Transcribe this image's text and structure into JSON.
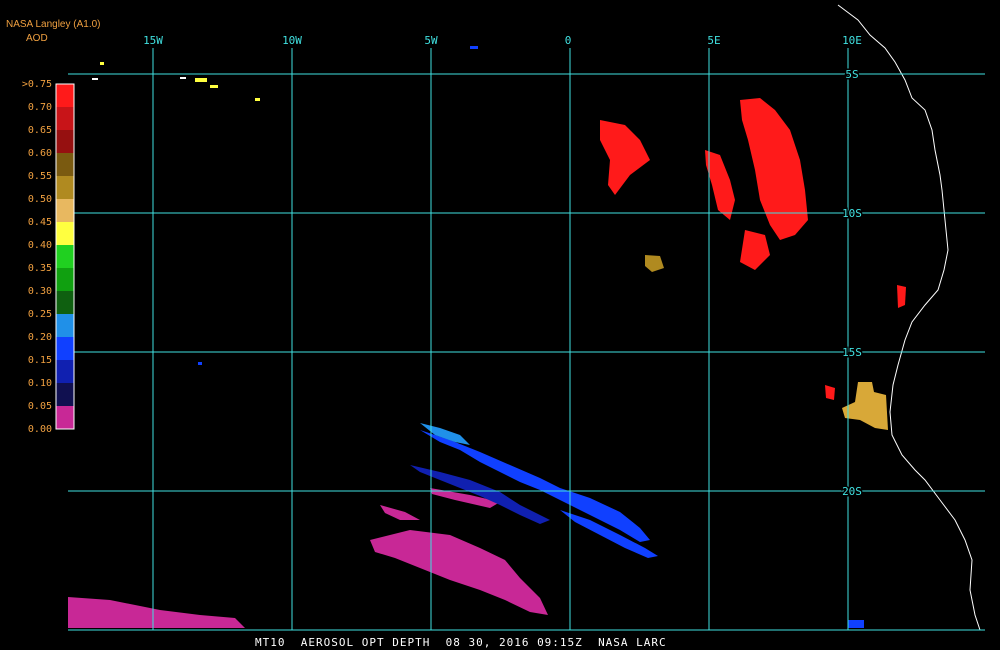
{
  "header": {
    "title": "NASA Langley (A1.0)",
    "units": "AOD"
  },
  "legend": {
    "labels": [
      ">0.75",
      "0.70",
      "0.65",
      "0.60",
      "0.55",
      "0.50",
      "0.45",
      "0.40",
      "0.35",
      "0.30",
      "0.25",
      "0.20",
      "0.15",
      "0.10",
      "0.05",
      "0.00"
    ],
    "colors": [
      "#ff1a1a",
      "#c81418",
      "#961010",
      "#7a5a10",
      "#b08a20",
      "#e8b860",
      "#ffff40",
      "#20d020",
      "#10a010",
      "#0f6010",
      "#2090e8",
      "#1040ff",
      "#1020b0",
      "#101050",
      "#c82896"
    ]
  },
  "grid": {
    "longitude_labels": [
      "15W",
      "10W",
      "5W",
      "0",
      "5E",
      "10E"
    ],
    "latitude_labels": [
      "5S",
      "10S",
      "15S",
      "20S"
    ]
  },
  "footer": {
    "product": "MT10",
    "title": "AEROSOL OPT DEPTH",
    "date": "08 30, 2016 09:15Z",
    "source": "NASA LARC"
  }
}
